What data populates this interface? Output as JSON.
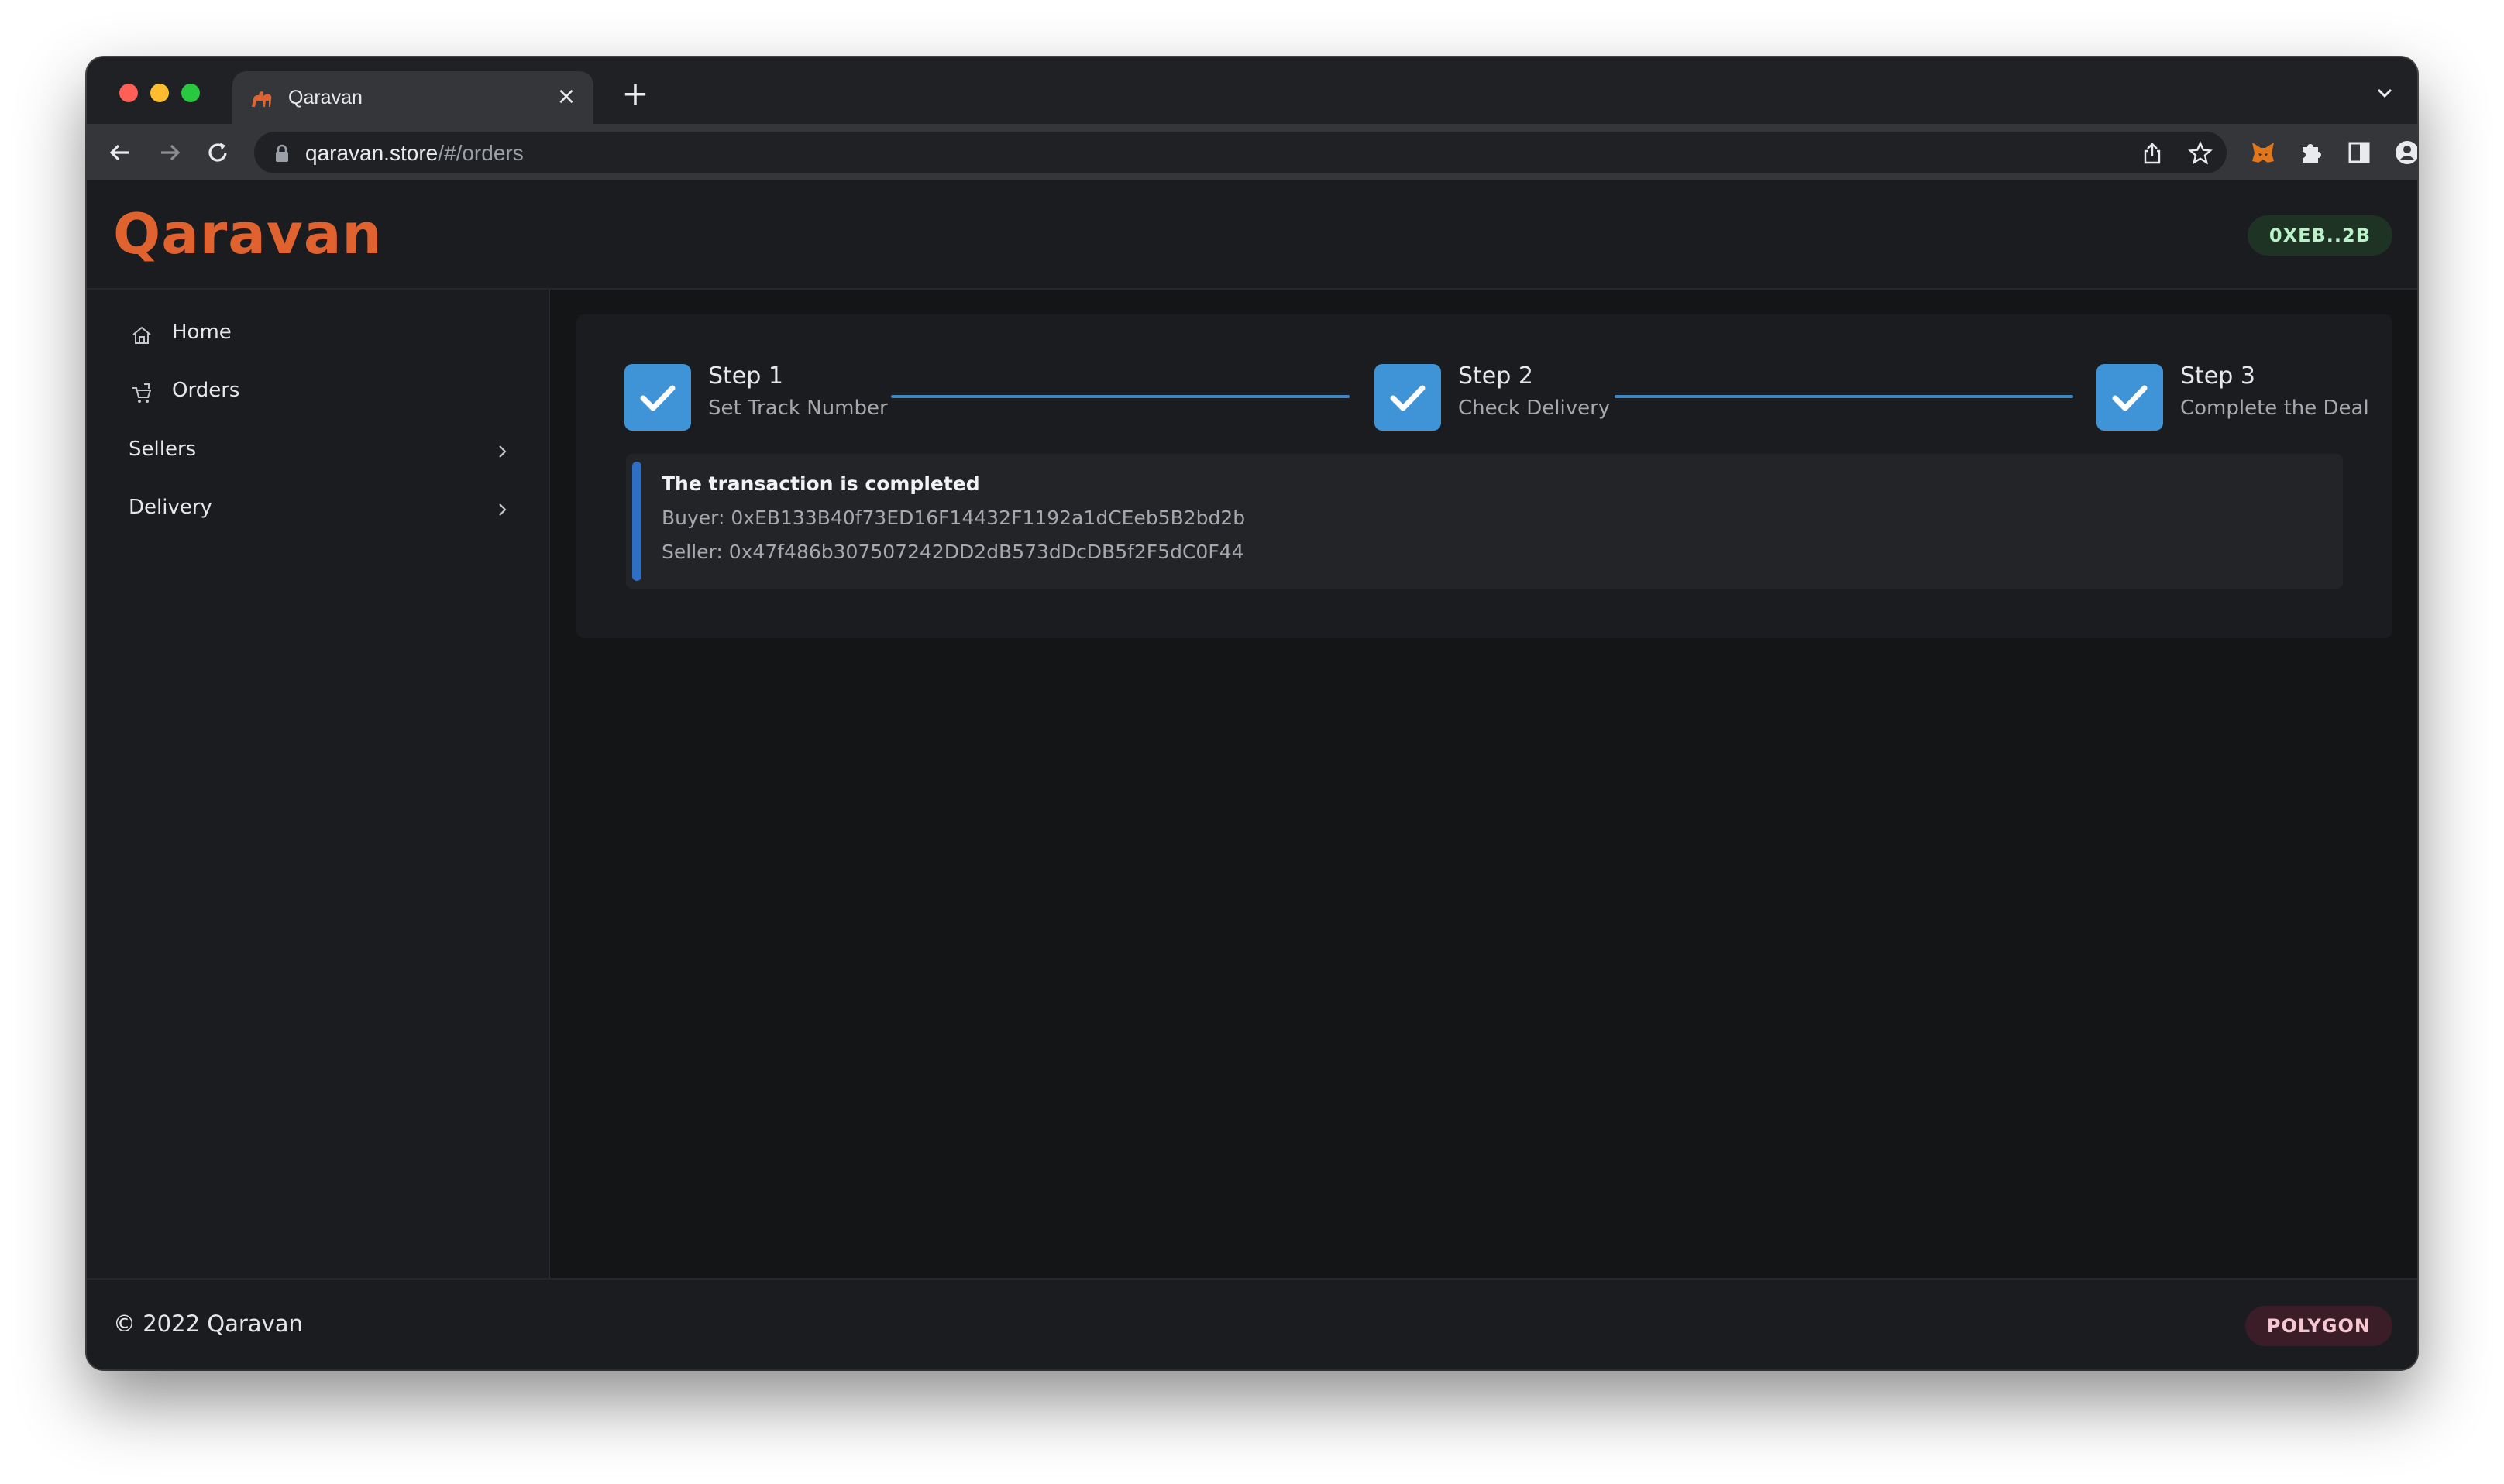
{
  "browser": {
    "tab": {
      "title": "Qaravan",
      "favicon": "camel-icon"
    },
    "address": {
      "domain": "qaravan.store",
      "path": "/#/orders"
    },
    "icons": [
      "back-icon",
      "forward-icon",
      "reload-icon",
      "lock-icon",
      "share-icon",
      "star-icon",
      "metamask-icon",
      "extensions-icon",
      "sidebar-icon",
      "profile-icon",
      "menu-icon"
    ]
  },
  "header": {
    "logo": "Qaravan",
    "wallet_badge": "0XEB..2B",
    "brand_color": "#e0622f"
  },
  "sidebar": {
    "items": [
      {
        "label": "Home",
        "icon": "home-icon"
      },
      {
        "label": "Orders",
        "icon": "orders-icon"
      },
      {
        "label": "Sellers",
        "icon": "chevron-right-icon"
      },
      {
        "label": "Delivery",
        "icon": "chevron-right-icon"
      }
    ]
  },
  "steps": [
    {
      "title": "Step 1",
      "subtitle": "Set Track Number",
      "completed": true
    },
    {
      "title": "Step 2",
      "subtitle": "Check Delivery",
      "completed": true
    },
    {
      "title": "Step 3",
      "subtitle": "Complete the Deal",
      "completed": true
    }
  ],
  "alert": {
    "title": "The transaction is completed",
    "buyer": "Buyer: 0xEB133B40f73ED16F14432F1192a1dCEeb5B2bd2b",
    "seller": "Seller: 0x47f486b307507242DD2dB573dDcDB5f2F5dC0F44"
  },
  "footer": {
    "copyright": "© 2022 Qaravan",
    "network_badge": "POLYGON"
  },
  "colors": {
    "accent": "#3f94d8",
    "wallet_badge_bg": "#1f3325",
    "network_badge_bg": "#3a1d27"
  }
}
